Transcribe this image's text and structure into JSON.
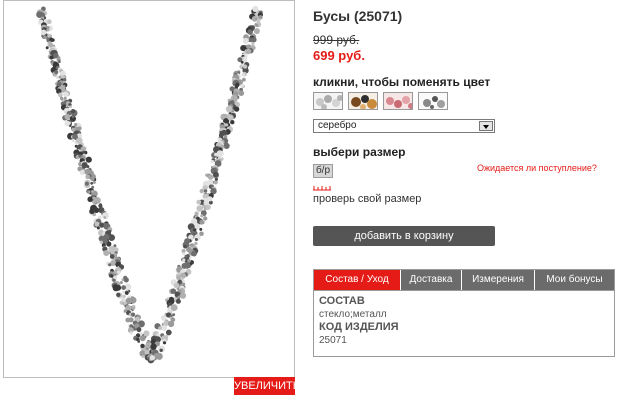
{
  "product": {
    "title": "Бусы (25071)",
    "old_price": "999 руб.",
    "new_price": "699 руб.",
    "zoom_label": "УВЕЛИЧИТЬ"
  },
  "colors": {
    "label": "кликни, чтобы поменять цвет",
    "swatches": [
      "silver",
      "brown",
      "pink",
      "grey"
    ],
    "selected": "серебро"
  },
  "size": {
    "label": "выбери размер",
    "options": [
      "б/р"
    ],
    "availability_link": "Ожидается ли поступление?",
    "check_size_link": "проверь свой размер"
  },
  "cart": {
    "add_label": "добавить в корзину"
  },
  "tabs": [
    {
      "label": "Состав / Уход",
      "active": true
    },
    {
      "label": "Доставка",
      "active": false
    },
    {
      "label": "Измерения",
      "active": false
    },
    {
      "label": "Мои бонусы",
      "active": false
    }
  ],
  "details": {
    "composition_heading": "СОСТАВ",
    "composition_value": "стекло;металл",
    "code_heading": "КОД ИЗДЕЛИЯ",
    "code_value": "25071"
  }
}
